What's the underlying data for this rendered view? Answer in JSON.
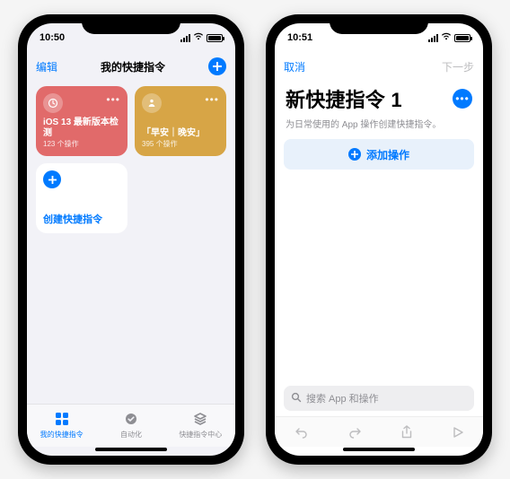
{
  "left": {
    "status": {
      "time": "10:50"
    },
    "nav": {
      "edit": "编辑",
      "title": "我的快捷指令"
    },
    "shortcuts": [
      {
        "title": "iOS 13 最新版本检测",
        "subtitle": "123 个操作"
      },
      {
        "title": "「早安｜晚安」",
        "subtitle": "395 个操作"
      }
    ],
    "create": {
      "label": "创建快捷指令"
    },
    "tabs": [
      {
        "label": "我的快捷指令"
      },
      {
        "label": "自动化"
      },
      {
        "label": "快捷指令中心"
      }
    ]
  },
  "right": {
    "status": {
      "time": "10:51"
    },
    "nav": {
      "cancel": "取消",
      "next": "下一步"
    },
    "title": "新快捷指令 1",
    "subtitle": "为日常使用的 App 操作创建快捷指令。",
    "add_action": "添加操作",
    "search_placeholder": "搜索 App 和操作"
  }
}
